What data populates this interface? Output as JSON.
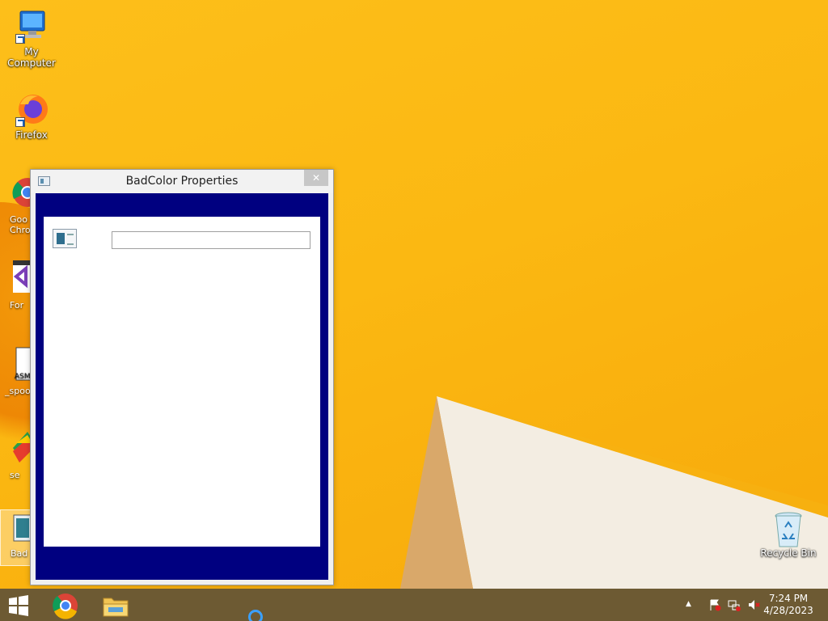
{
  "desktop": {
    "icons": [
      {
        "label": "My Computer",
        "icon": "computer-icon"
      },
      {
        "label": "Firefox",
        "icon": "firefox-icon"
      },
      {
        "label": "Recycle Bin",
        "icon": "recycle-bin-icon"
      }
    ],
    "partial_icons": [
      {
        "label": "Goo\nChro",
        "icon": "chrome-icon"
      },
      {
        "label": "For",
        "icon": "visual-studio-icon"
      },
      {
        "label": "_spoof",
        "icon": "asm-icon"
      },
      {
        "label": "se",
        "icon": "installer-icon"
      },
      {
        "label": "Bad",
        "icon": "badcolor-app-icon"
      }
    ]
  },
  "window": {
    "title": "BadColor Properties",
    "close_label": "✕",
    "client_color": "#000080",
    "field_value": ""
  },
  "taskbar": {
    "time": "7:24 PM",
    "date": "4/28/2023",
    "color": "#6d5a33"
  }
}
